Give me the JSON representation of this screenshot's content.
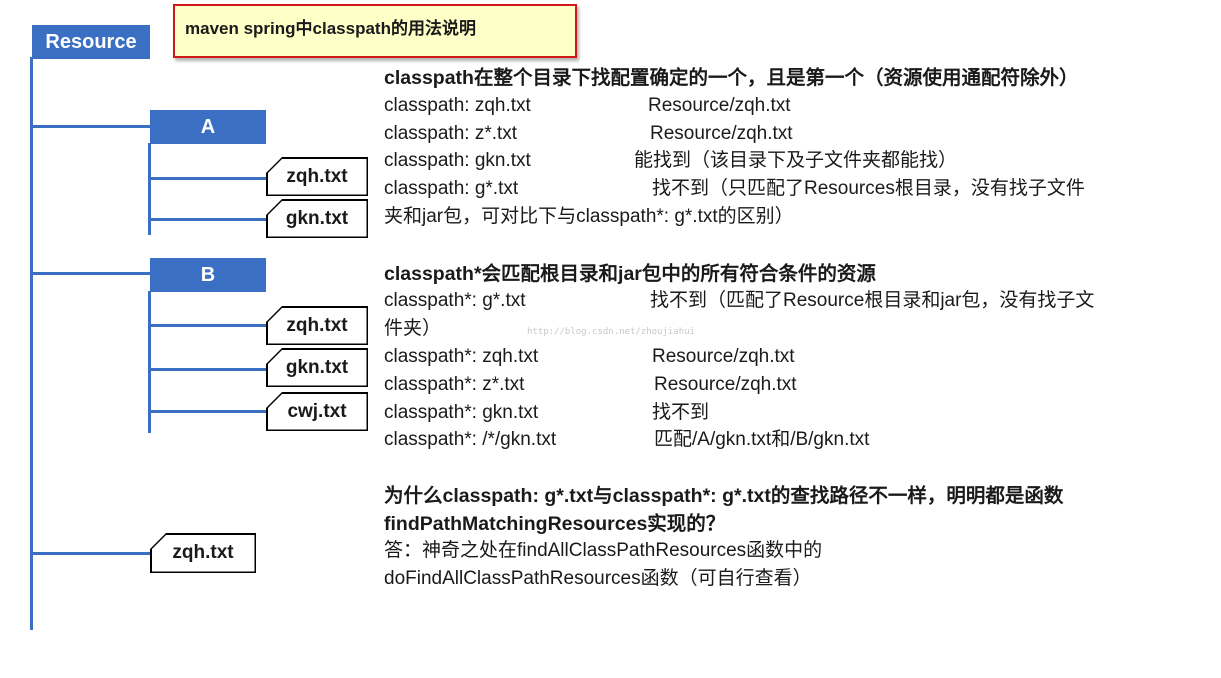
{
  "note": {
    "title": "maven spring中classpath的用法说明"
  },
  "tree": {
    "root": "Resource",
    "folder_a": "A",
    "folder_b": "B",
    "a_files": [
      "zqh.txt",
      "gkn.txt"
    ],
    "b_files": [
      "zqh.txt",
      "gkn.txt",
      "cwj.txt"
    ],
    "root_file": "zqh.txt"
  },
  "section1": {
    "heading": "classpath在整个目录下找配置确定的一个，且是第一个（资源使用通配符除外）",
    "rows": [
      {
        "pattern": "classpath: zqh.txt",
        "result": "Resource/zqh.txt"
      },
      {
        "pattern": "classpath: z*.txt",
        "result": "Resource/zqh.txt"
      },
      {
        "pattern": "classpath: gkn.txt",
        "result": "能找到（该目录下及子文件夹都能找）"
      },
      {
        "pattern": "classpath: g*.txt",
        "result": "找不到（只匹配了Resources根目录，没有找子文件"
      }
    ],
    "continuation": "夹和jar包，可对比下与classpath*: g*.txt的区别）"
  },
  "section2": {
    "heading": "classpath*会匹配根目录和jar包中的所有符合条件的资源",
    "row0": {
      "pattern": "classpath*: g*.txt",
      "result": "找不到（匹配了Resource根目录和jar包，没有找子文"
    },
    "continuation": "件夹）",
    "rows": [
      {
        "pattern": "classpath*: zqh.txt",
        "result": "Resource/zqh.txt"
      },
      {
        "pattern": "classpath*: z*.txt",
        "result": "Resource/zqh.txt"
      },
      {
        "pattern": "classpath*: gkn.txt",
        "result": "找不到"
      },
      {
        "pattern": "classpath*: /*/gkn.txt",
        "result": "匹配/A/gkn.txt和/B/gkn.txt"
      }
    ]
  },
  "section3": {
    "question_line1": "为什么classpath: g*.txt与classpath*: g*.txt的查找路径不一样，明明都是函数",
    "question_line2": "findPathMatchingResources实现的？",
    "answer_line1": "答：神奇之处在findAllClassPathResources函数中的",
    "answer_line2": "doFindAllClassPathResources函数（可自行查看）"
  },
  "watermark": "http://blog.csdn.net/zhoujiahui",
  "colors": {
    "tree_blue": "#3a6fc4",
    "note_fill": "#ffffc8",
    "note_border": "#d01818"
  }
}
